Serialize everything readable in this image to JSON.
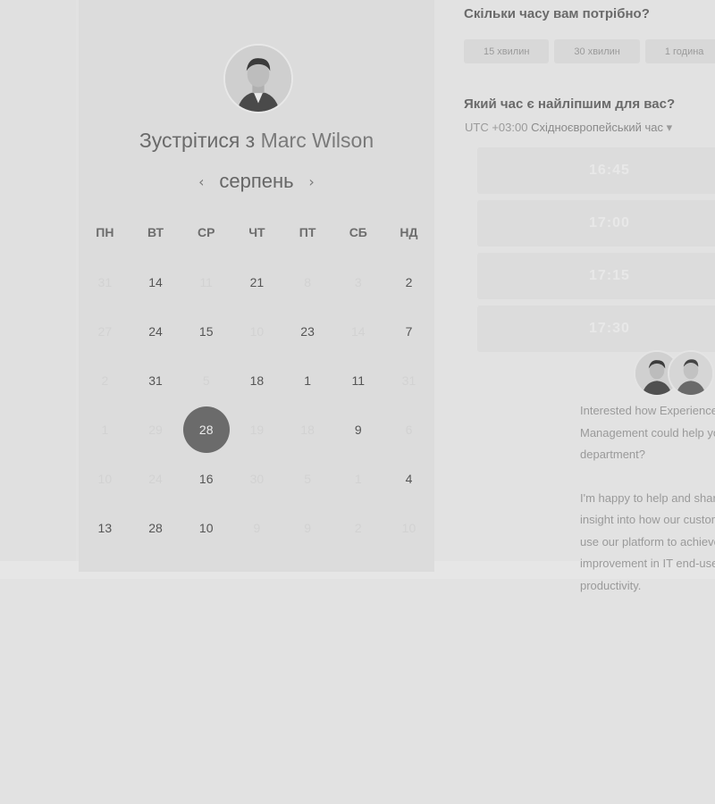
{
  "meeting": {
    "prefix": "Зустрітися з ",
    "host": "Marc Wilson"
  },
  "calendar": {
    "month": "серпень",
    "prev": "‹",
    "next": "›",
    "weekdays": [
      "ПН",
      "ВТ",
      "СР",
      "ЧТ",
      "ПТ",
      "СБ",
      "НД"
    ],
    "days": [
      {
        "d": "31",
        "s": "faded"
      },
      {
        "d": "14",
        "s": "active"
      },
      {
        "d": "11",
        "s": "faded"
      },
      {
        "d": "21",
        "s": "active"
      },
      {
        "d": "8",
        "s": "faded"
      },
      {
        "d": "3",
        "s": "faded"
      },
      {
        "d": "2",
        "s": "active"
      },
      {
        "d": "27",
        "s": "faded"
      },
      {
        "d": "24",
        "s": "active"
      },
      {
        "d": "15",
        "s": "active"
      },
      {
        "d": "10",
        "s": "faded"
      },
      {
        "d": "23",
        "s": "active"
      },
      {
        "d": "14",
        "s": "faded"
      },
      {
        "d": "7",
        "s": "active"
      },
      {
        "d": "2",
        "s": "faded"
      },
      {
        "d": "31",
        "s": "active"
      },
      {
        "d": "5",
        "s": "faded"
      },
      {
        "d": "18",
        "s": "active"
      },
      {
        "d": "1",
        "s": "active"
      },
      {
        "d": "11",
        "s": "active"
      },
      {
        "d": "31",
        "s": "faded"
      },
      {
        "d": "1",
        "s": "faded"
      },
      {
        "d": "29",
        "s": "faded"
      },
      {
        "d": "28",
        "s": "selected"
      },
      {
        "d": "19",
        "s": "faded"
      },
      {
        "d": "18",
        "s": "faded"
      },
      {
        "d": "9",
        "s": "active"
      },
      {
        "d": "6",
        "s": "faded"
      },
      {
        "d": "10",
        "s": "faded"
      },
      {
        "d": "24",
        "s": "faded"
      },
      {
        "d": "16",
        "s": "active"
      },
      {
        "d": "30",
        "s": "faded"
      },
      {
        "d": "5",
        "s": "faded"
      },
      {
        "d": "1",
        "s": "faded"
      },
      {
        "d": "4",
        "s": "active"
      },
      {
        "d": "13",
        "s": "active"
      },
      {
        "d": "28",
        "s": "active"
      },
      {
        "d": "10",
        "s": "active"
      },
      {
        "d": "9",
        "s": "faded"
      },
      {
        "d": "9",
        "s": "faded"
      },
      {
        "d": "2",
        "s": "faded"
      },
      {
        "d": "10",
        "s": "faded"
      }
    ]
  },
  "duration": {
    "question": "Скільки часу вам потрібно?",
    "options": [
      "15 хвилин",
      "30 хвилин",
      "1 година"
    ]
  },
  "time": {
    "question": "Який час є найліпшим для вас?",
    "tz_offset": "UTC +03:00",
    "tz_name": "Східноєвропейський час",
    "tz_caret": "▾",
    "slots": [
      "16:45",
      "17:00",
      "17:15",
      "17:30"
    ]
  },
  "bio": {
    "p1": [
      "Interested how Experience",
      "Management could help your",
      "department?"
    ],
    "p2": [
      "I'm happy to help and share",
      "insight into how our customers",
      "use our platform to achieve",
      "improvement in IT end-user",
      "productivity."
    ]
  },
  "colors": {
    "selected_day": "#6b6b6b",
    "background": "#e2e2e2"
  }
}
